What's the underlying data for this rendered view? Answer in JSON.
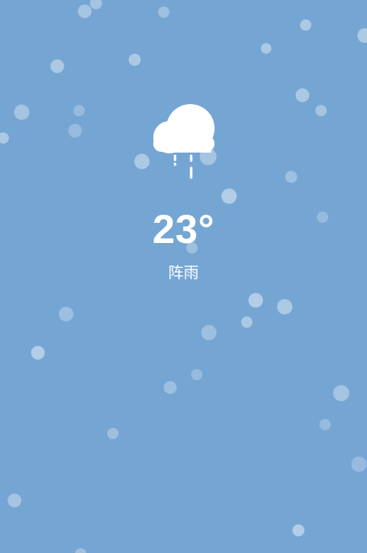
{
  "weather": {
    "temperature": "23°",
    "condition": "阵雨",
    "icon": "cloud-rain-icon"
  },
  "colors": {
    "background": "#75a5d3",
    "particle": "#ffffff",
    "text": "#ffffff"
  }
}
